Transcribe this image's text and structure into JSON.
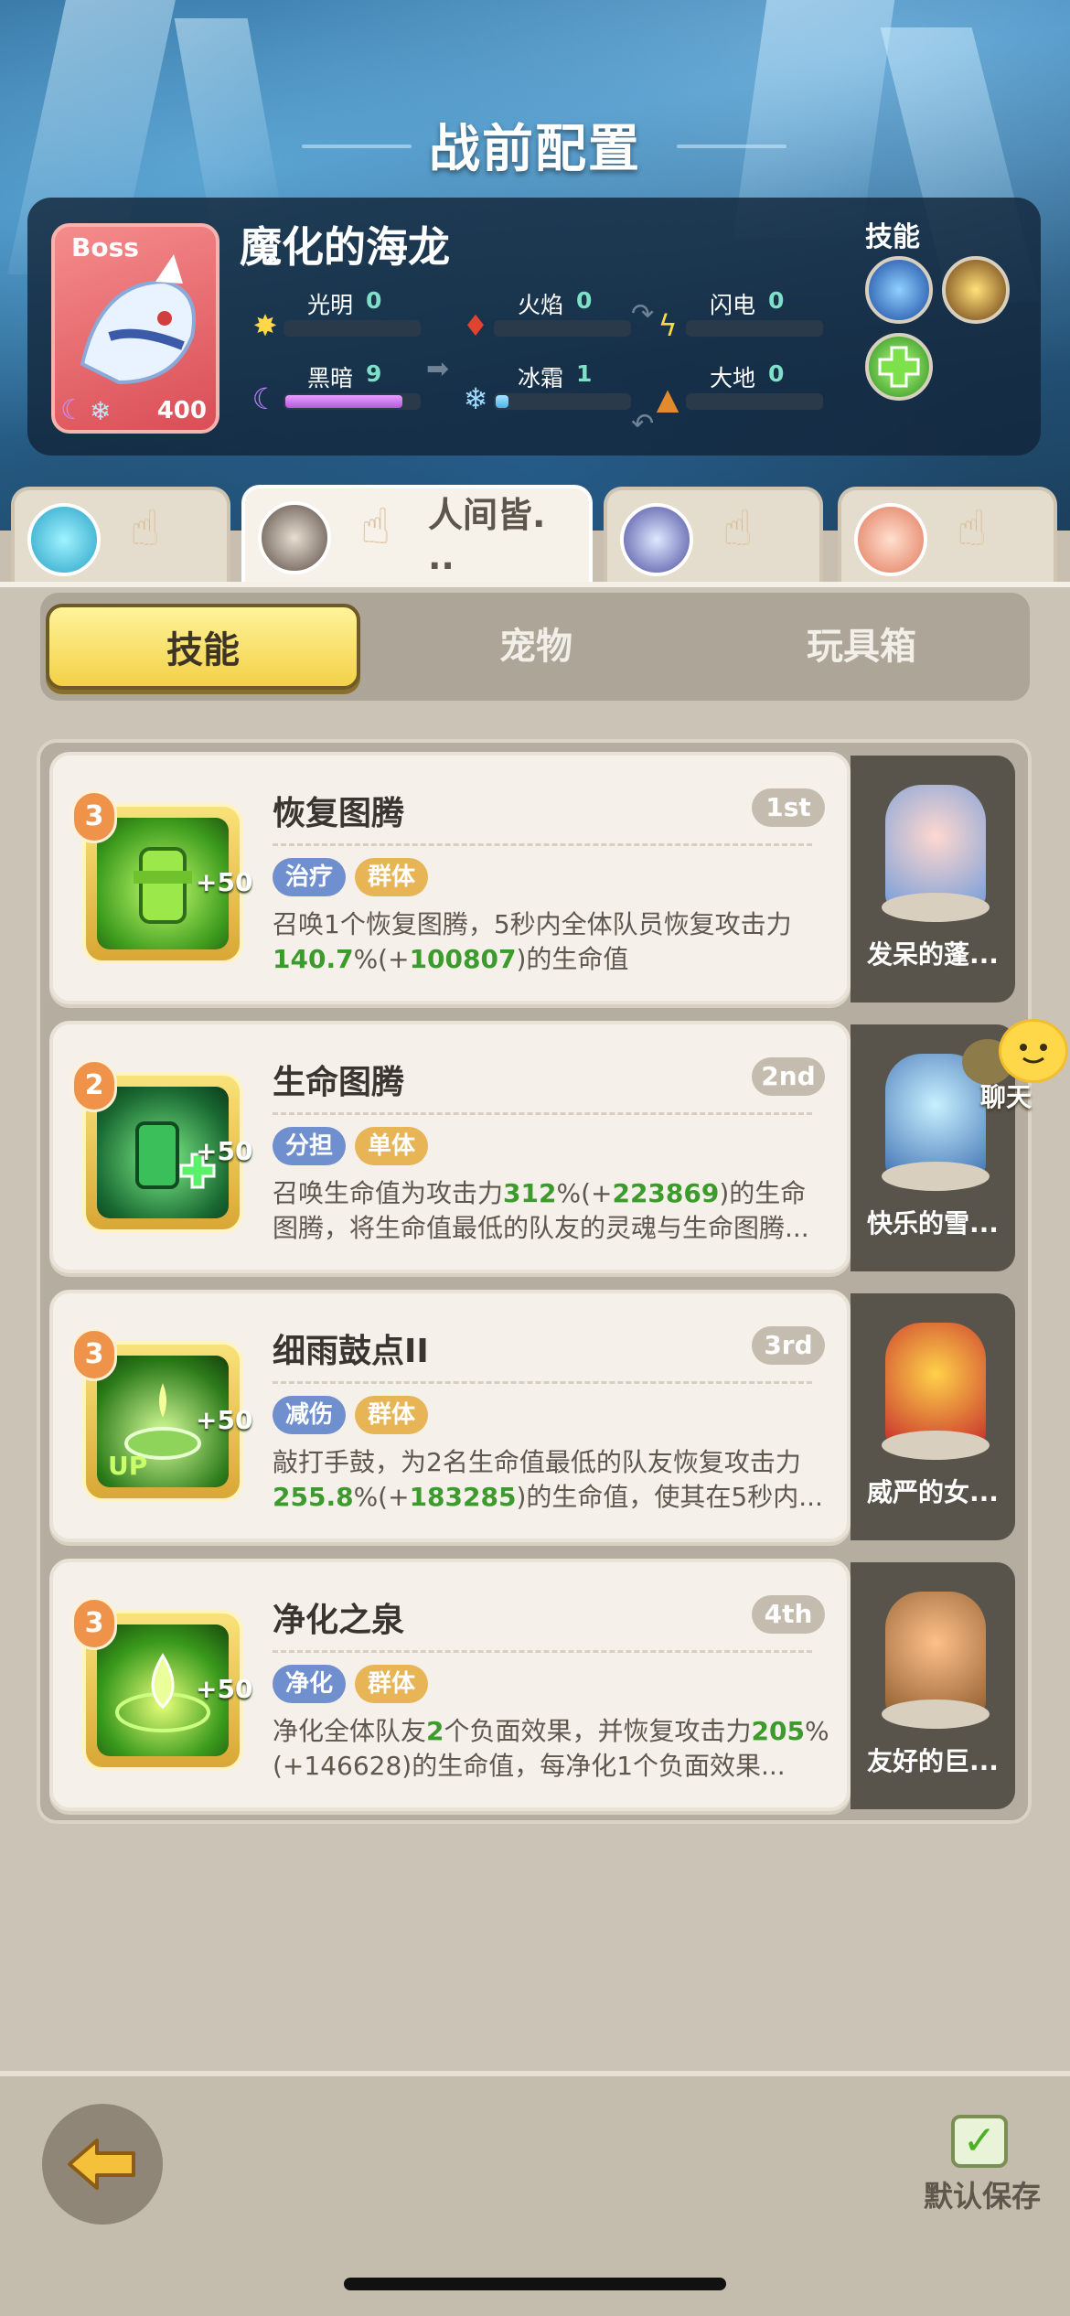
{
  "header": {
    "title": "战前配置"
  },
  "boss": {
    "tag": "Boss",
    "name": "魔化的海龙",
    "level": "400",
    "elements": [
      {
        "label": "光明",
        "value": "0"
      },
      {
        "label": "火焰",
        "value": "0"
      },
      {
        "label": "闪电",
        "value": "0"
      },
      {
        "label": "黑暗",
        "value": "9"
      },
      {
        "label": "冰霜",
        "value": "1"
      },
      {
        "label": "大地",
        "value": "0"
      }
    ],
    "skills_label": "技能"
  },
  "heroes": [
    {
      "name": ""
    },
    {
      "name": "人间皆.\n.."
    },
    {
      "name": ""
    },
    {
      "name": ""
    }
  ],
  "segments": {
    "skills": "技能",
    "pets": "宠物",
    "toybox": "玩具箱"
  },
  "skills": [
    {
      "level": "3",
      "bonus": "+50",
      "name": "恢复图腾",
      "order": "1st",
      "tags": [
        "治疗",
        "群体"
      ],
      "desc_a": "召唤1个恢复图腾，5秒内全体队员恢复攻击力",
      "desc_hl1": "140.7",
      "desc_b": "%(+",
      "desc_hl2": "100807",
      "desc_c": ")的生命值",
      "pet_name": "发呆的蓬..."
    },
    {
      "level": "2",
      "bonus": "+50",
      "name": "生命图腾",
      "order": "2nd",
      "tags": [
        "分担",
        "单体"
      ],
      "desc_a": "召唤生命值为攻击力",
      "desc_hl1": "312",
      "desc_b": "%(+",
      "desc_hl2": "223869",
      "desc_c": ")的生命图腾，将生命值最低的队友的灵魂与生命图腾...",
      "pet_name": "快乐的雪..."
    },
    {
      "level": "3",
      "bonus": "+50",
      "name": "细雨鼓点II",
      "order": "3rd",
      "tags": [
        "减伤",
        "群体"
      ],
      "desc_a": "敲打手鼓，为2名生命值最低的队友恢复攻击力",
      "desc_hl1": "255.8",
      "desc_b": "%(+",
      "desc_hl2": "183285",
      "desc_c": ")的生命值，使其在5秒内...",
      "icon_badge": "UP",
      "pet_name": "威严的女..."
    },
    {
      "level": "3",
      "bonus": "+50",
      "name": "净化之泉",
      "order": "4th",
      "tags": [
        "净化",
        "群体"
      ],
      "desc_a": "净化全体队友",
      "desc_hl1": "2",
      "desc_b": "个负面效果，并恢复攻击力",
      "desc_hl2": "205",
      "desc_c": "%(+146628)的生命值，每净化1个负面效果...",
      "pet_name": "友好的巨..."
    }
  ],
  "chat": {
    "label": "聊天"
  },
  "footer": {
    "save_label": "默认保存"
  },
  "colors": {
    "accent_yellow": "#f3d147",
    "highlight_green": "#3d9a2c",
    "tag_blue": "#6f8fcf",
    "tag_gold": "#e7b456"
  }
}
